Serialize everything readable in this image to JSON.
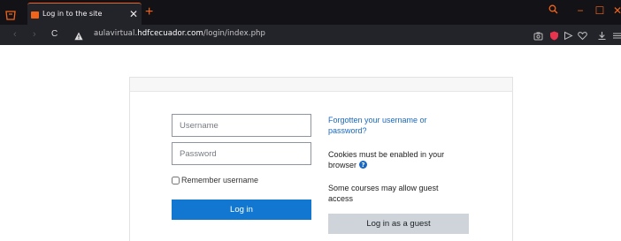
{
  "browser": {
    "tab_title": "Log in to the site",
    "tab_close_glyph": "✕",
    "new_tab_glyph": "+",
    "back_glyph": "‹",
    "forward_glyph": "›",
    "reload_glyph": "C",
    "url_prefix": "aulavirtual.",
    "url_host": "hdfcecuador.com",
    "url_path": "/login/index.php",
    "minimize_glyph": "−",
    "maximize_glyph": "☐",
    "close_glyph": "✕",
    "accent_color": "#f2631a"
  },
  "login": {
    "username_placeholder": "Username",
    "password_placeholder": "Password",
    "remember_label": "Remember username",
    "login_button": "Log in",
    "forgot_link": "Forgotten your username or password?",
    "cookies_text": "Cookies must be enabled in your browser",
    "guest_note": "Some courses may allow guest access",
    "guest_button": "Log in as a guest",
    "primary_color": "#1177d1",
    "link_color": "#1768c4"
  }
}
